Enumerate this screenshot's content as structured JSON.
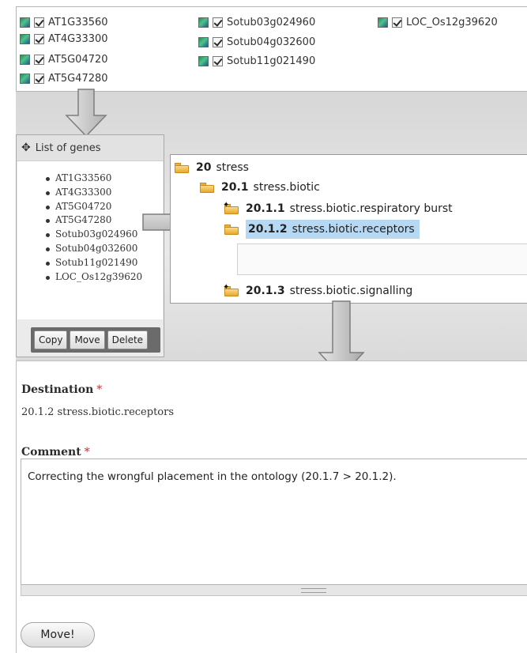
{
  "genes_panel_top": {
    "items": [
      {
        "label": "AT1G33560",
        "checked": true
      },
      {
        "label": "AT4G33300",
        "checked": true
      },
      {
        "label": "AT5G04720",
        "checked": true
      },
      {
        "label": "AT5G47280",
        "checked": true
      },
      {
        "label": "Sotub03g024960",
        "checked": true
      },
      {
        "label": "Sotub04g032600",
        "checked": true
      },
      {
        "label": "Sotub11g021490",
        "checked": true
      },
      {
        "label": "LOC_Os12g39620",
        "checked": true
      }
    ]
  },
  "list_panel": {
    "title": "List of genes",
    "genes": [
      "AT1G33560",
      "AT4G33300",
      "AT5G04720",
      "AT5G47280",
      "Sotub03g024960",
      "Sotub04g032600",
      "Sotub11g021490",
      "LOC_Os12g39620"
    ],
    "buttons": {
      "copy": "Copy",
      "move": "Move",
      "delete": "Delete"
    }
  },
  "tree": {
    "nodes": [
      {
        "id": "20",
        "name": "stress"
      },
      {
        "id": "20.1",
        "name": "stress.biotic"
      },
      {
        "id": "20.1.1",
        "name": "stress.biotic.respiratory burst"
      },
      {
        "id": "20.1.2",
        "name": "stress.biotic.receptors",
        "selected": true
      },
      {
        "id": "20.1.3",
        "name": "stress.biotic.signalling"
      }
    ]
  },
  "form": {
    "destination_label": "Destination",
    "destination_value": "20.1.2 stress.biotic.receptors",
    "comment_label": "Comment",
    "required_mark": "*",
    "comment_value": "Correcting the wrongful placement in the ontology (20.1.7 > 20.1.2).",
    "submit_label": "Move!"
  },
  "colors": {
    "selection": "#b6d8f2",
    "required": "#d0262a",
    "folder": "#e9a92b"
  }
}
